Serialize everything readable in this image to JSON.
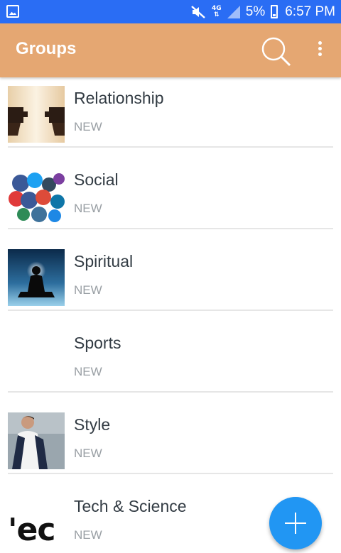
{
  "status_bar": {
    "network": "4G",
    "battery": "5%",
    "time": "6:57 PM"
  },
  "app_bar": {
    "title": "Groups"
  },
  "groups": [
    {
      "name": "Relationship",
      "label": "NEW",
      "thumbnail": "puzzle-hands-image"
    },
    {
      "name": "Social",
      "label": "NEW",
      "thumbnail": "social-logos-image"
    },
    {
      "name": "Spiritual",
      "label": "NEW",
      "thumbnail": "meditation-silhouette-image"
    },
    {
      "name": "Sports",
      "label": "NEW",
      "thumbnail": ""
    },
    {
      "name": "Style",
      "label": "NEW",
      "thumbnail": "man-in-jacket-image"
    },
    {
      "name": "Tech & Science",
      "label": "NEW",
      "thumbnail": "ec-text-image",
      "thumbnail_text": "'ec"
    }
  ],
  "colors": {
    "status_bar": "#2a6df4",
    "app_bar": "#e5a772",
    "fab": "#2196f3"
  }
}
